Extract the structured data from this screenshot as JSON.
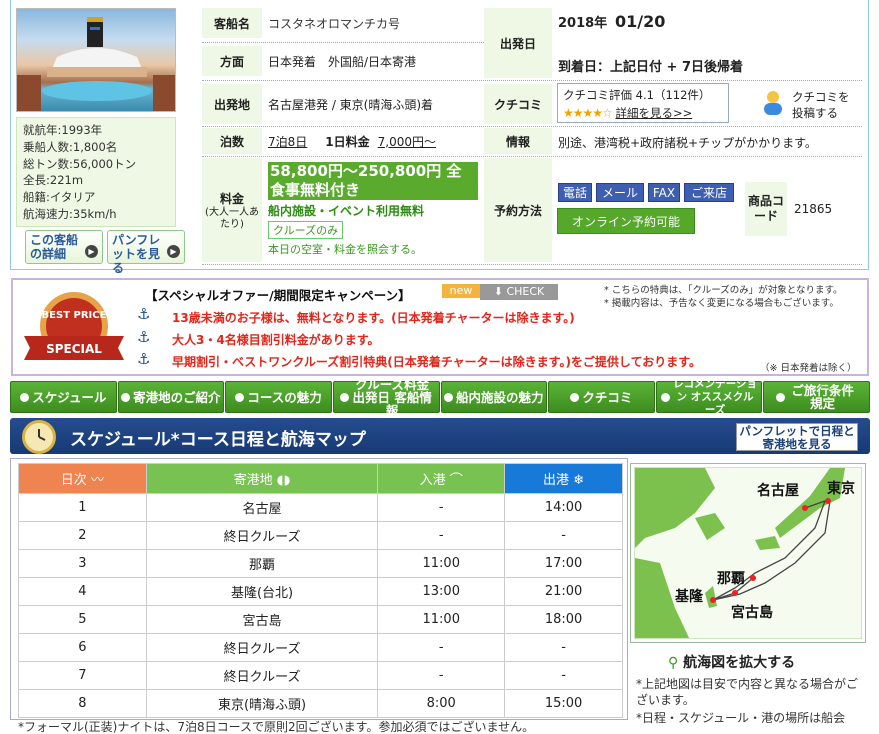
{
  "ship": {
    "specs": [
      "就航年:1993年",
      "乗船人数:1,800名",
      "総トン数:56,000トン",
      "全長:221m",
      "船籍:イタリア",
      "航海速力:35km/h"
    ],
    "detail_btn": "この客船の詳細",
    "pamphlet_btn": "パンフレットを見る",
    "name_label": "客船名",
    "name_value": "コスタネオロマンチカ号",
    "direction_label": "方面",
    "direction_value": "日本発着　外国船/日本寄港",
    "depart_place_label": "出発地",
    "depart_place_value": "名古屋港発 / 東京(晴海ふ頭)着",
    "nights_label": "泊数",
    "nights_value": "7泊8日",
    "day_price_label": "1日料金",
    "day_price_value": "7,000円〜",
    "price_label": "料金",
    "price_sub": "(大人一人あたり)",
    "price_value": "58,800円〜250,800円 全食事無料付き",
    "price_included": "船内施設・イベント利用無料",
    "cruise_only": "クルーズのみ",
    "price_check": "本日の空室・料金を照会する。",
    "depart_date_label": "出発日",
    "depart_year": "2018年",
    "depart_date": "01/20",
    "arrival": "到着日：上記日付 + 7日後帰着",
    "review_label": "クチコミ",
    "review_score": "クチコミ評価 4.1（112件）",
    "review_stars": "★★★★☆",
    "review_link": "詳細を見る>>",
    "post_review": "クチコミを投稿する",
    "info_label": "情報",
    "info_value": "別途、港湾税+政府諸税+チップがかかります。",
    "booking_label": "予約方法",
    "booking_methods": [
      "電話",
      "メール",
      "FAX",
      "ご来店"
    ],
    "online_booking": "オンライン予約可能",
    "product_code_label": "商品コード",
    "product_code": "21865"
  },
  "campaign": {
    "badge_top": "BEST PRICE",
    "badge_bottom": "SPECIAL",
    "title": "【スペシャルオファー/期間限定キャンペーン】",
    "new_tag": "new",
    "check_tag": "CHECK",
    "note1": "* こちらの特典は、「クルーズのみ」が対象となります。",
    "note2": "* 掲載内容は、予告なく変更になる場合もございます。",
    "items": [
      "13歳未満のお子様は、無料となります。(日本発着チャーターは除きます。)",
      "大人3・4名様目割引料金があります。",
      "早期割引・ベストワンクルーズ割引特典(日本発着チャーターは除きます。)をご提供しております。"
    ],
    "note3": "（※ 日本発着は除く）"
  },
  "nav": [
    "スケジュール",
    "寄港地のご紹介",
    "コースの魅力",
    "クルーズ料金 出発日 客船情報",
    "船内施設の魅力",
    "クチコミ",
    "レコメンデーション オススメクルーズ",
    "ご旅行条件 規定"
  ],
  "section": {
    "title": "スケジュール*コース日程と航海マップ",
    "pamphlet": "パンフレットで日程と寄港地を見る"
  },
  "schedule": {
    "headers": [
      "日次",
      "寄港地",
      "入港",
      "出港"
    ],
    "rows": [
      [
        "1",
        "名古屋",
        "-",
        "14:00"
      ],
      [
        "2",
        "終日クルーズ",
        "-",
        "-"
      ],
      [
        "3",
        "那覇",
        "11:00",
        "17:00"
      ],
      [
        "4",
        "基隆(台北)",
        "13:00",
        "21:00"
      ],
      [
        "5",
        "宮古島",
        "11:00",
        "18:00"
      ],
      [
        "6",
        "終日クルーズ",
        "-",
        "-"
      ],
      [
        "7",
        "終日クルーズ",
        "-",
        "-"
      ],
      [
        "8",
        "東京(晴海ふ頭)",
        "8:00",
        "15:00"
      ]
    ],
    "footnote": "*フォーマル(正装)ナイトは、7泊8日コースで原則2回ございます。参加必須ではございません。"
  },
  "map": {
    "labels": [
      "名古屋",
      "東京",
      "那覇",
      "基隆",
      "宮古島"
    ],
    "zoom": "航海図を拡大する",
    "note1": "*上記地図は目安で内容と異なる場合がございます。",
    "note2": "*日程・スケジュール・港の場所は船会"
  },
  "colors": {
    "green": "#55a829",
    "navy": "#1b3f7a",
    "red": "#e2261b",
    "orange": "#ef8451",
    "blue": "#1779d8"
  }
}
